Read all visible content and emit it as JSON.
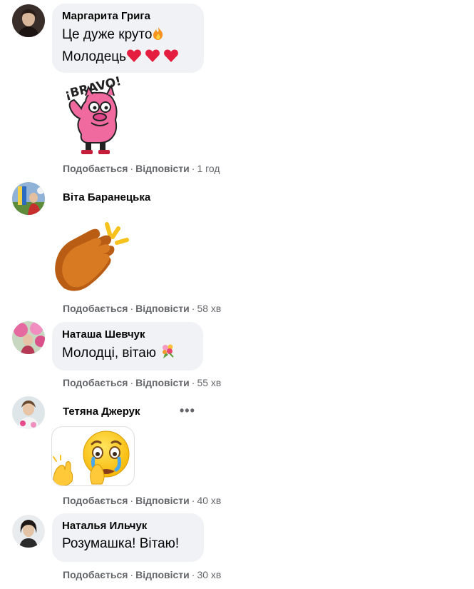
{
  "actions": {
    "like": "Подобається",
    "reply": "Відповісти",
    "separator": "·"
  },
  "comments": [
    {
      "author": "Маргарита Грига",
      "lines": [
        "Це дуже круто",
        "Молодець"
      ],
      "line_emojis": [
        "fire-emoji",
        "three-red-hearts-emoji"
      ],
      "sticker": "bravo-pig-sticker",
      "sticker_text": "¡BRAVO!",
      "time": "1 год"
    },
    {
      "author": "Віта Баранецька",
      "sticker": "clapping-hands-sticker",
      "time": "58 хв"
    },
    {
      "author": "Наташа Шевчук",
      "lines": [
        "Молодці, вітаю"
      ],
      "line_emojis": [
        "bouquet-emoji"
      ],
      "time": "55 хв"
    },
    {
      "author": "Тетяна Джерук",
      "more": "•••",
      "sticker": "crying-clapping-emoji",
      "time": "40 хв"
    },
    {
      "author": "Наталья Ильчук",
      "lines": [
        "Розумашка! Вітаю!"
      ],
      "time": "30 хв"
    }
  ],
  "colors": {
    "bubble": "#f0f2f5",
    "meta_text": "#65676b",
    "heart": "#e41e3f",
    "fire": "#f7931e"
  }
}
